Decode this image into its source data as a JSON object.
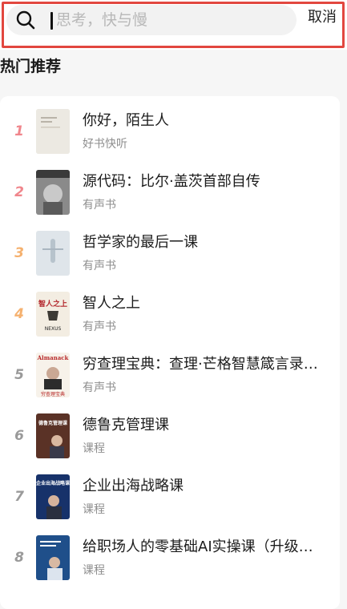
{
  "search": {
    "placeholder": "思考，快与慢",
    "cancel_label": "取消"
  },
  "section": {
    "title": "热门推荐"
  },
  "colors": {
    "rank_top": "#f0868c",
    "rank_mid": "#f5b16f",
    "rank_low": "#9a9a9a",
    "highlight": "#e2473f"
  },
  "items": [
    {
      "rank": "1",
      "title": "你好，陌生人",
      "sub": "好书快听"
    },
    {
      "rank": "2",
      "title": "源代码：比尔·盖茨首部自传",
      "sub": "有声书"
    },
    {
      "rank": "3",
      "title": "哲学家的最后一课",
      "sub": "有声书"
    },
    {
      "rank": "4",
      "title": "智人之上",
      "sub": "有声书",
      "cover_text": "智人之上",
      "cover_text2": "NEXUS"
    },
    {
      "rank": "5",
      "title": "穷查理宝典：查理·芒格智慧箴言录…",
      "sub": "有声书",
      "cover_text": "Almanack",
      "cover_text2": "穷查理宝典"
    },
    {
      "rank": "6",
      "title": "德鲁克管理课",
      "sub": "课程",
      "cover_text": "德鲁克管理课"
    },
    {
      "rank": "7",
      "title": "企业出海战略课",
      "sub": "课程",
      "cover_text": "企业出海战略课"
    },
    {
      "rank": "8",
      "title": "给职场人的零基础AI实操课（升级版…",
      "sub": "课程"
    }
  ]
}
